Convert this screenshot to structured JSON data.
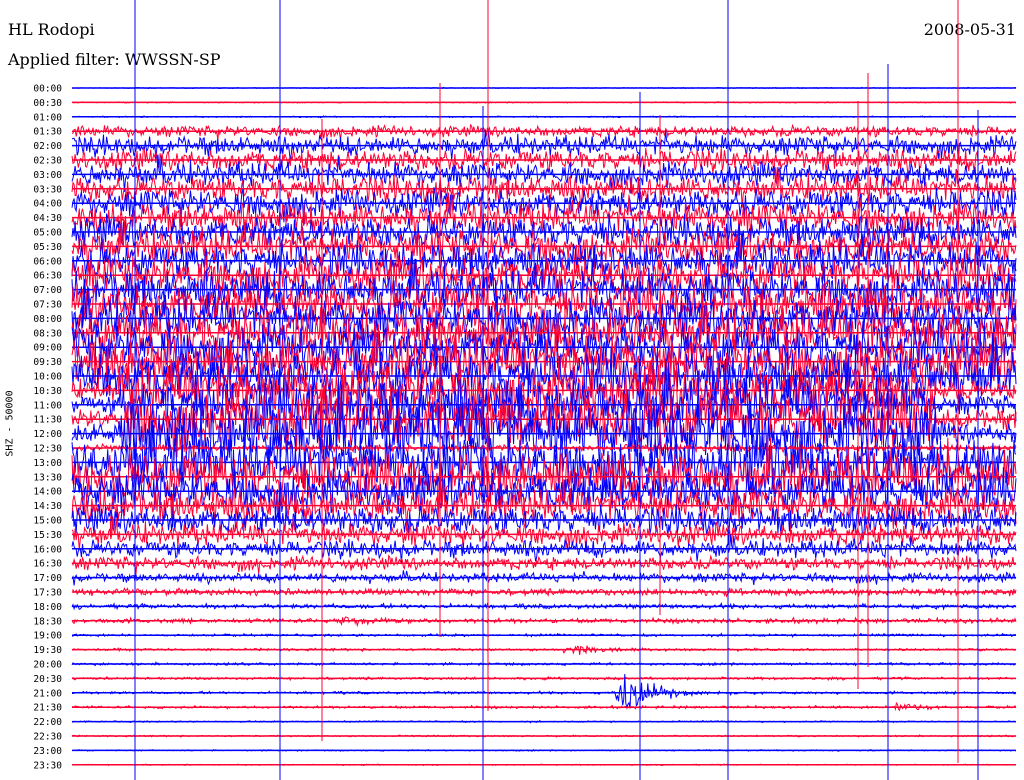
{
  "header": {
    "station": "HL Rodopi",
    "filter": "Applied filter: WWSSN-SP",
    "date": "2008-05-31"
  },
  "chart_data": {
    "type": "line",
    "title": "HL Rodopi",
    "date": "2008-05-31",
    "ylabel": "SHZ - 50000",
    "colors": {
      "trace_a": "#0000ff",
      "trace_b": "#ff0033"
    },
    "rows": [
      "00:00",
      "00:30",
      "01:00",
      "01:30",
      "02:00",
      "02:30",
      "03:00",
      "03:30",
      "04:00",
      "04:30",
      "05:00",
      "05:30",
      "06:00",
      "06:30",
      "07:00",
      "07:30",
      "08:00",
      "08:30",
      "09:00",
      "09:30",
      "10:00",
      "10:30",
      "11:00",
      "11:30",
      "12:00",
      "12:30",
      "13:00",
      "13:30",
      "14:00",
      "14:30",
      "15:00",
      "15:30",
      "16:00",
      "16:30",
      "17:00",
      "17:30",
      "18:00",
      "18:30",
      "19:00",
      "19:30",
      "20:00",
      "20:30",
      "21:00",
      "21:30",
      "22:00",
      "22:30",
      "23:00",
      "23:30"
    ],
    "amplitude_level": [
      0.02,
      0.03,
      0.04,
      0.5,
      0.9,
      1.0,
      1.1,
      1.2,
      1.3,
      1.4,
      1.5,
      1.6,
      1.7,
      1.8,
      1.9,
      2.0,
      2.0,
      2.1,
      2.2,
      2.3,
      2.4,
      2.5,
      2.6,
      2.8,
      3.0,
      0.3,
      2.6,
      2.4,
      2.0,
      1.6,
      1.3,
      1.0,
      0.8,
      0.6,
      0.4,
      0.3,
      0.2,
      0.2,
      0.1,
      0.1,
      0.1,
      0.1,
      0.1,
      0.1,
      0.05,
      0.05,
      0.04,
      0.03
    ],
    "events": [
      {
        "row": "18:30",
        "minute": 8.5,
        "amplitude": 0.6
      },
      {
        "row": "19:30",
        "minute": 15.8,
        "amplitude": 0.7
      },
      {
        "row": "21:00",
        "minute": 17.5,
        "amplitude": 2.2
      },
      {
        "row": "21:30",
        "minute": 26.2,
        "amplitude": 0.5
      }
    ]
  }
}
